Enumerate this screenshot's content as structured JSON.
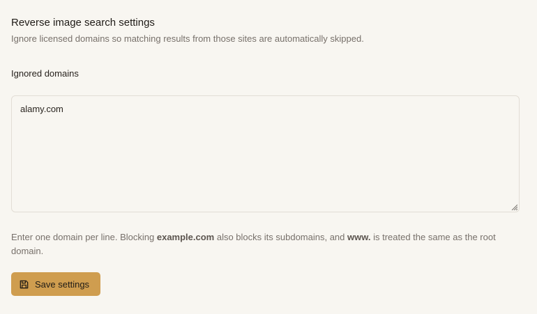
{
  "settings": {
    "title": "Reverse image search settings",
    "subtitle": "Ignore licensed domains so matching results from those sites are automatically skipped."
  },
  "ignored_domains": {
    "label": "Ignored domains",
    "value": "alamy.com"
  },
  "help": {
    "before_example": "Enter one domain per line. Blocking ",
    "example_domain": "example.com",
    "between": " also blocks its subdomains, and ",
    "www_prefix": "www.",
    "after_www": " is treated the same as the root domain."
  },
  "actions": {
    "save_label": "Save settings",
    "save_icon": "save-icon"
  },
  "colors": {
    "background": "#f8f6f1",
    "button": "#cf9d4f",
    "muted_text": "#77706a",
    "border": "#e2ddd5"
  }
}
